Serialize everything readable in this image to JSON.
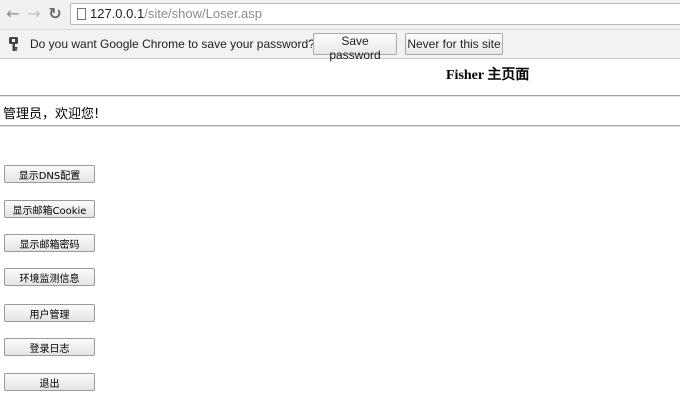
{
  "browser": {
    "url_host": "127.0.0.1",
    "url_path": "/site/show/Loser.asp",
    "back_icon": "arrow-left-icon",
    "forward_icon": "arrow-right-icon",
    "reload_icon": "reload-icon"
  },
  "infobar": {
    "message": "Do you want Google Chrome to save your password?",
    "save_label": "Save password",
    "never_label": "Never for this site"
  },
  "page": {
    "title": "Fisher 主页面",
    "welcome": "管理员，欢迎您!",
    "buttons": [
      {
        "label": "显示DNS配置"
      },
      {
        "label": "显示邮箱Cookie"
      },
      {
        "label": "显示邮箱密码"
      },
      {
        "label": "环境监测信息"
      },
      {
        "label": "用户管理"
      },
      {
        "label": "登录日志"
      },
      {
        "label": "退出"
      }
    ]
  }
}
